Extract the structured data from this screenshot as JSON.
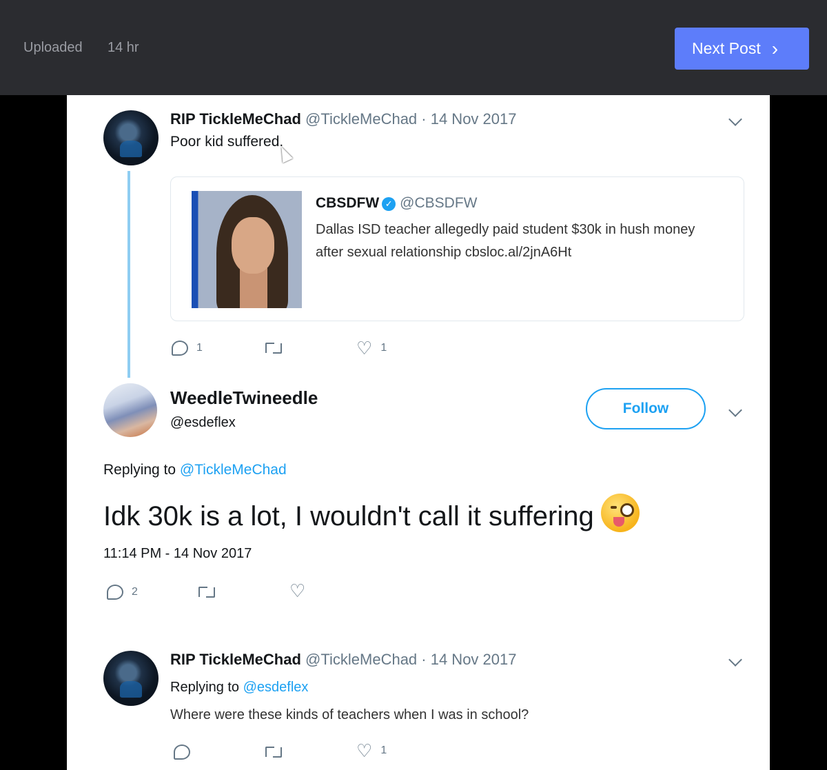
{
  "topbar": {
    "uploaded_label": "Uploaded",
    "uploaded_time": "14 hr",
    "next_button": "Next Post",
    "next_icon": "chevron-right-icon",
    "accent_color": "#5d7dfa"
  },
  "tweet1": {
    "author": "RIP TickleMeChad",
    "meta": "@TickleMeChad · 14 Nov 2017",
    "text": "Poor kid suffered.",
    "quote": {
      "author": "CBSDFW",
      "handle": "@CBSDFW",
      "text": "Dallas ISD teacher allegedly paid student $30k in hush money after sexual relationship  cbsloc.al/2jnA6Ht"
    },
    "reply_count": "1",
    "like_count": "1"
  },
  "main_tweet": {
    "author": "WeedleTwineedle",
    "handle": "@esdeflex",
    "follow_label": "Follow",
    "replying_prefix": "Replying to",
    "replying_to": "@TickleMeChad",
    "text": "Idk 30k is a lot, I wouldn't call it suffering",
    "timestamp": "11:14 PM - 14 Nov 2017",
    "reply_count": "2"
  },
  "tweet3": {
    "author": "RIP TickleMeChad",
    "meta": "@TickleMeChad · 14 Nov 2017",
    "replying_prefix": "Replying to",
    "replying_to": "@esdeflex",
    "text": "Where were these kinds of teachers when I was in school?",
    "like_count": "1"
  },
  "colors": {
    "link": "#1da1f2",
    "muted": "#657786",
    "text": "#14171a"
  }
}
